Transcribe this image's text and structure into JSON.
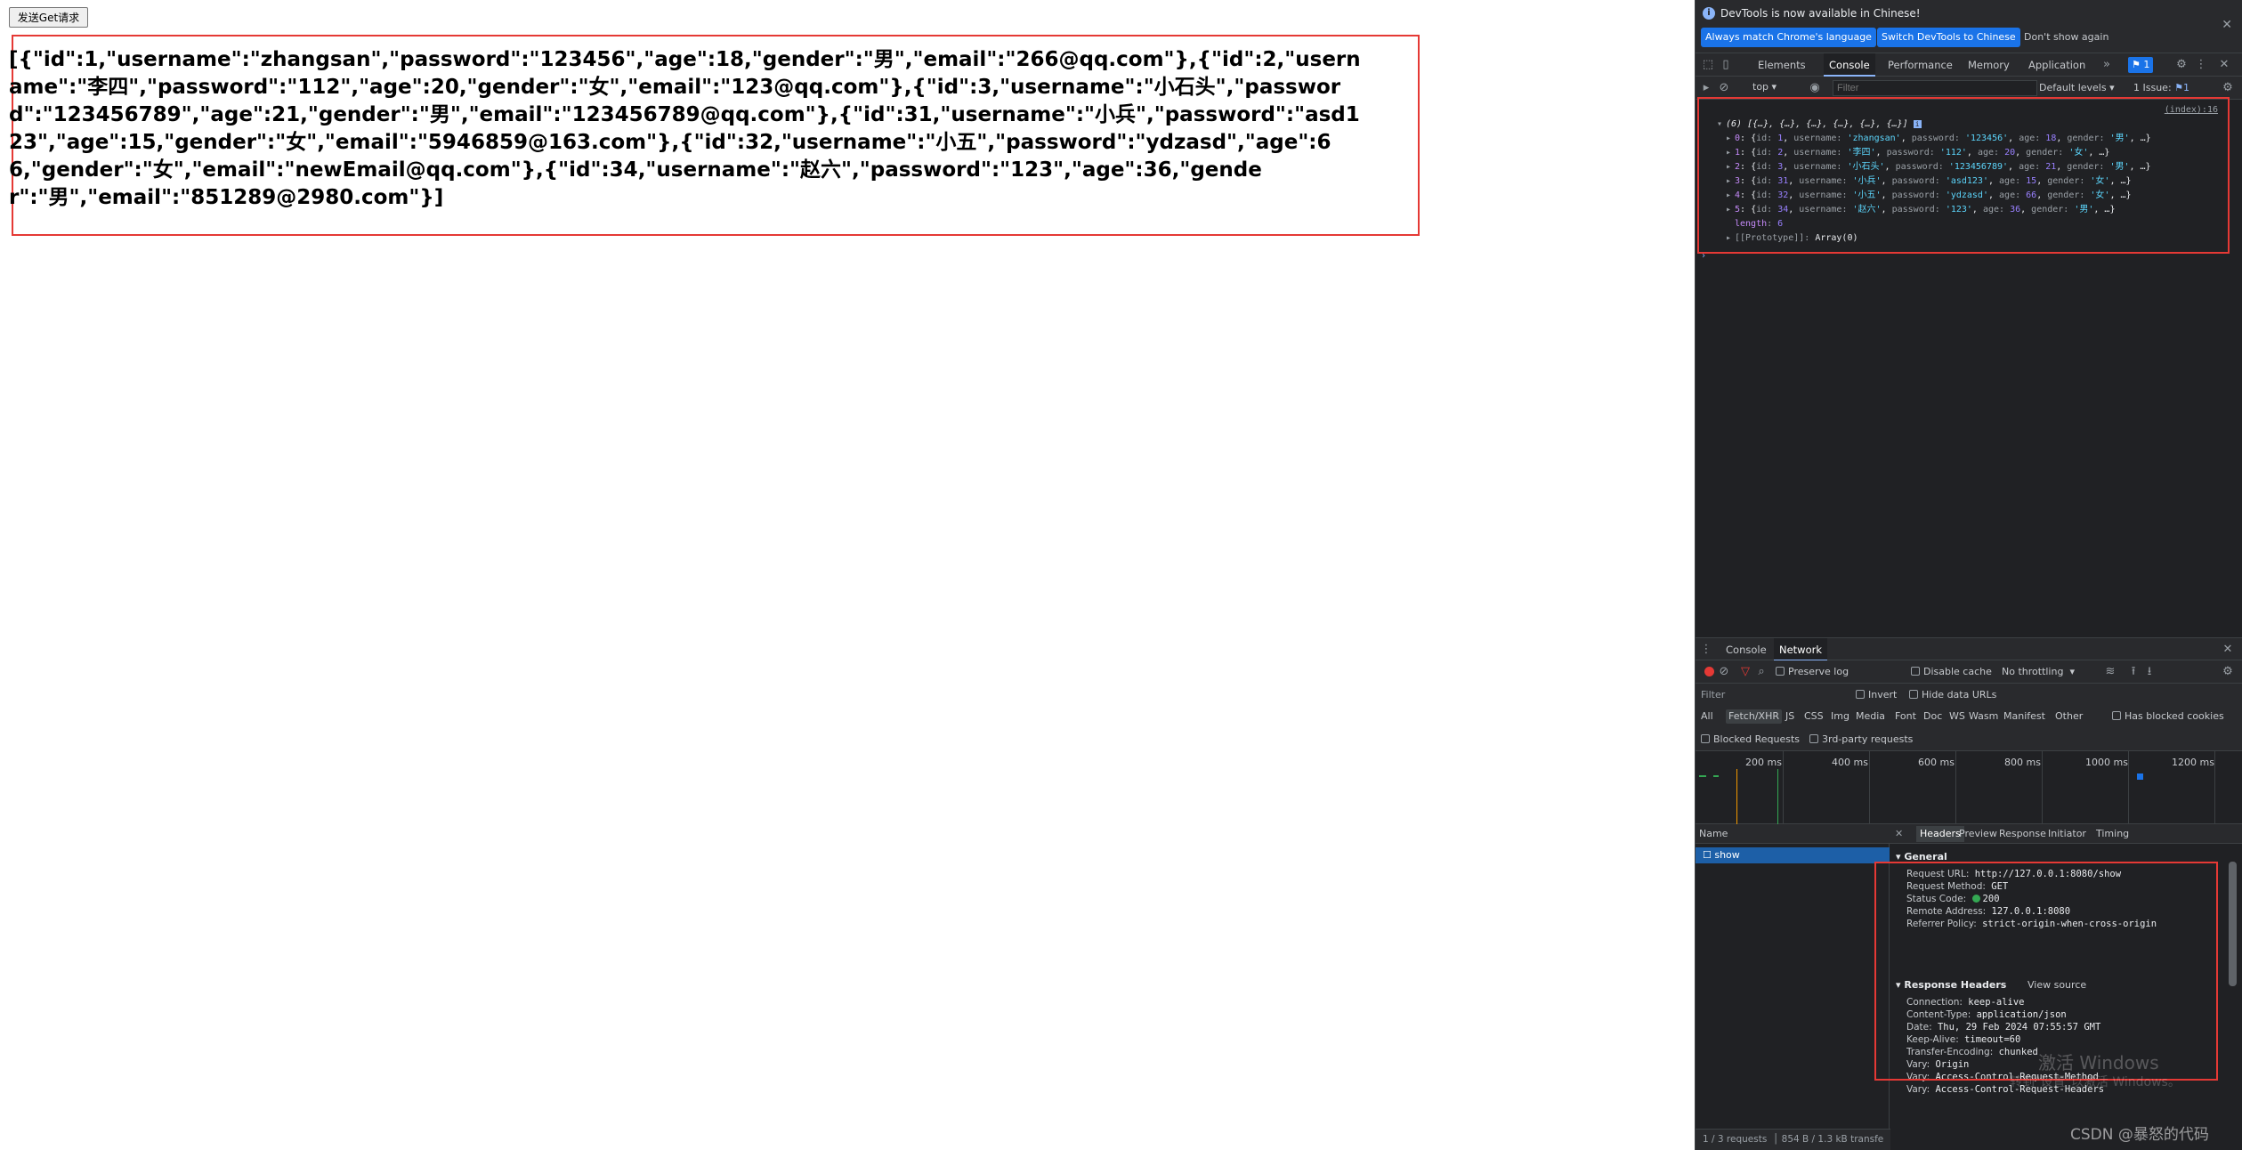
{
  "page": {
    "button_label": "发送Get请求",
    "response_text": "[{\"id\":1,\"username\":\"zhangsan\",\"password\":\"123456\",\"age\":18,\"gender\":\"男\",\"email\":\"266@qq.com\"},{\"id\":2,\"username\":\"李四\",\"password\":\"112\",\"age\":20,\"gender\":\"女\",\"email\":\"123@qq.com\"},{\"id\":3,\"username\":\"小石头\",\"password\":\"123456789\",\"age\":21,\"gender\":\"男\",\"email\":\"123456789@qq.com\"},{\"id\":31,\"username\":\"小兵\",\"password\":\"asd123\",\"age\":15,\"gender\":\"女\",\"email\":\"5946859@163.com\"},{\"id\":32,\"username\":\"小五\",\"password\":\"ydzasd\",\"age\":66,\"gender\":\"女\",\"email\":\"newEmail@qq.com\"},{\"id\":34,\"username\":\"赵六\",\"password\":\"123\",\"age\":36,\"gender\":\"男\",\"email\":\"851289@2980.com\"}]"
  },
  "devtools": {
    "infobar": {
      "message": "DevTools is now available in Chinese!",
      "btn_match": "Always match Chrome's language",
      "btn_switch": "Switch DevTools to Chinese",
      "btn_dont": "Don't show again"
    },
    "tabs": [
      "Elements",
      "Console",
      "Performance",
      "Memory",
      "Application"
    ],
    "issue_chip": "1",
    "console_toolbar": {
      "context": "top",
      "filter_placeholder": "Filter",
      "levels": "Default levels",
      "issues": "1 Issue:"
    },
    "console": {
      "source": "(index):16",
      "summary": "(6) [{…}, {…}, {…}, {…}, {…}, {…}]",
      "rows": [
        {
          "idx": "0",
          "id": "1",
          "username": "'zhangsan'",
          "password": "'123456'",
          "age": "18",
          "gender": "'男'"
        },
        {
          "idx": "1",
          "id": "2",
          "username": "'李四'",
          "password": "'112'",
          "age": "20",
          "gender": "'女'"
        },
        {
          "idx": "2",
          "id": "3",
          "username": "'小石头'",
          "password": "'123456789'",
          "age": "21",
          "gender": "'男'"
        },
        {
          "idx": "3",
          "id": "31",
          "username": "'小兵'",
          "password": "'asd123'",
          "age": "15",
          "gender": "'女'"
        },
        {
          "idx": "4",
          "id": "32",
          "username": "'小五'",
          "password": "'ydzasd'",
          "age": "66",
          "gender": "'女'"
        },
        {
          "idx": "5",
          "id": "34",
          "username": "'赵六'",
          "password": "'123'",
          "age": "36",
          "gender": "'男'"
        }
      ],
      "length_label": "length",
      "length_value": "6",
      "prototype": "[[Prototype]]",
      "prototype_value": "Array(0)"
    },
    "drawer_tabs": [
      "Console",
      "Network"
    ],
    "network": {
      "preserve_log": "Preserve log",
      "disable_cache": "Disable cache",
      "throttling": "No throttling",
      "filter_label": "Filter",
      "invert": "Invert",
      "hide_data_urls": "Hide data URLs",
      "types": [
        "All",
        "Fetch/XHR",
        "JS",
        "CSS",
        "Img",
        "Media",
        "Font",
        "Doc",
        "WS",
        "Wasm",
        "Manifest",
        "Other"
      ],
      "has_blocked_cookies": "Has blocked cookies",
      "blocked_requests": "Blocked Requests",
      "third_party": "3rd-party requests",
      "ticks": [
        "200 ms",
        "400 ms",
        "600 ms",
        "800 ms",
        "1000 ms",
        "1200 ms"
      ],
      "name_col": "Name",
      "request_name": "show",
      "footer": "1 / 3 requests",
      "footer_size": "854 B / 1.3 kB transfe",
      "detail_tabs": [
        "Headers",
        "Preview",
        "Response",
        "Initiator",
        "Timing"
      ],
      "general_title": "General",
      "general": [
        {
          "k": "Request URL:",
          "v": "http://127.0.0.1:8080/show"
        },
        {
          "k": "Request Method:",
          "v": "GET"
        },
        {
          "k": "Status Code:",
          "v": "200"
        },
        {
          "k": "Remote Address:",
          "v": "127.0.0.1:8080"
        },
        {
          "k": "Referrer Policy:",
          "v": "strict-origin-when-cross-origin"
        }
      ],
      "response_headers_title": "Response Headers",
      "view_source": "View source",
      "response_headers": [
        {
          "k": "Connection:",
          "v": "keep-alive"
        },
        {
          "k": "Content-Type:",
          "v": "application/json"
        },
        {
          "k": "Date:",
          "v": "Thu, 29 Feb 2024 07:55:57 GMT"
        },
        {
          "k": "Keep-Alive:",
          "v": "timeout=60"
        },
        {
          "k": "Transfer-Encoding:",
          "v": "chunked"
        },
        {
          "k": "Vary:",
          "v": "Origin"
        },
        {
          "k": "Vary:",
          "v": "Access-Control-Request-Method"
        },
        {
          "k": "Vary:",
          "v": "Access-Control-Request-Headers"
        }
      ]
    }
  },
  "overlay": {
    "watermark_line1": "激活 Windows",
    "watermark_line2": "转到\"设置\"以激活 Windows。",
    "csdn": "CSDN @暴怒的代码"
  },
  "colors": {
    "highlight_box": "#e53935",
    "devtools_bg": "#202124",
    "accent": "#1a73e8"
  }
}
